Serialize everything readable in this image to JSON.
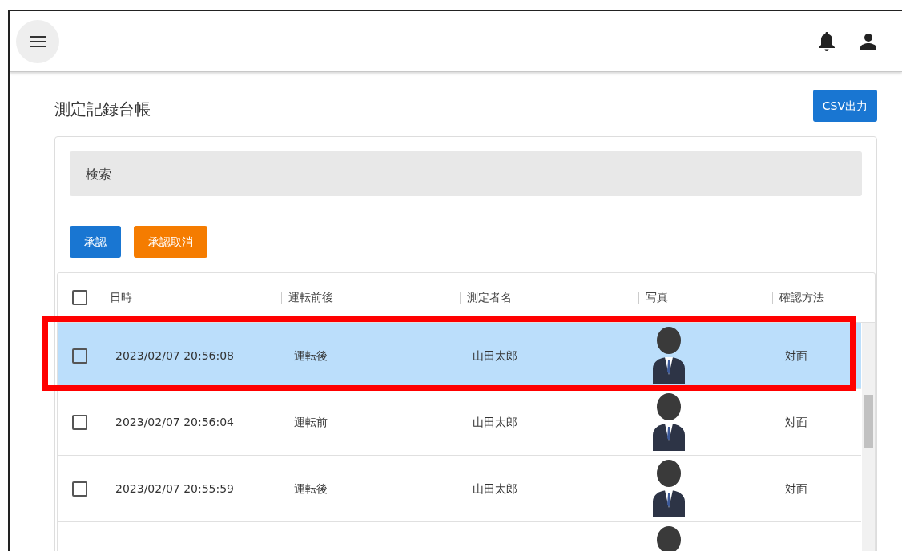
{
  "title": "測定記録台帳",
  "export_button": "CSV出力",
  "search": {
    "placeholder": "検索"
  },
  "actions": [
    {
      "label": "承認",
      "kind": "approve"
    },
    {
      "label": "承認取消",
      "kind": "revoke"
    }
  ],
  "table": {
    "all_checked": false,
    "columns": [
      "日時",
      "運転前後",
      "測定者名",
      "写真",
      "確認方法"
    ],
    "rows": [
      {
        "selected": true,
        "checked": false,
        "datetime": "2023/02/07 20:56:08",
        "timing": "運転後",
        "measurer": "山田太郎",
        "method": "対面"
      },
      {
        "selected": false,
        "checked": false,
        "datetime": "2023/02/07 20:56:04",
        "timing": "運転前",
        "measurer": "山田太郎",
        "method": "対面"
      },
      {
        "selected": false,
        "checked": false,
        "datetime": "2023/02/07 20:55:59",
        "timing": "運転後",
        "measurer": "山田太郎",
        "method": "対面"
      },
      {
        "selected": false
      }
    ]
  }
}
